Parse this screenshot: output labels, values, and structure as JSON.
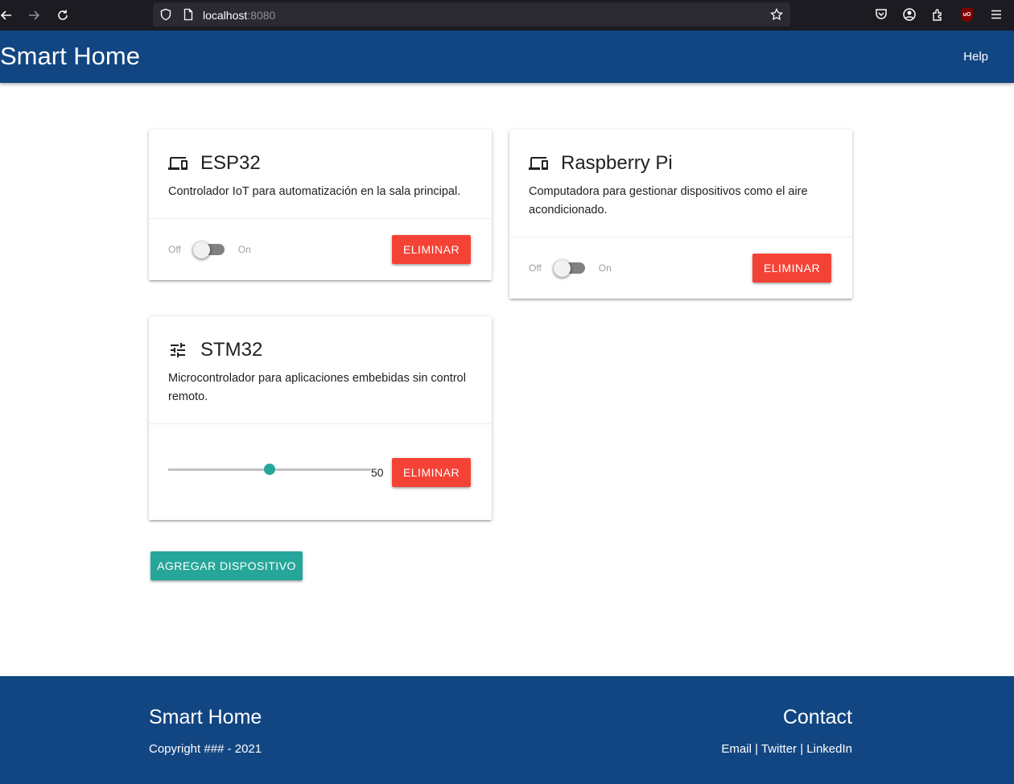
{
  "browser": {
    "url_host": "localhost",
    "url_port": ":8080"
  },
  "header": {
    "title": "Smart Home",
    "help_label": "Help"
  },
  "devices": [
    {
      "name": "ESP32",
      "icon": "devices-icon",
      "description": "Controlador IoT para automatización en la sala principal.",
      "control": "switch",
      "switch_off_label": "Off",
      "switch_on_label": "On",
      "switch_state": false,
      "delete_label": "ELIMINAR"
    },
    {
      "name": "Raspberry Pi",
      "icon": "devices-icon",
      "description": "Computadora para gestionar dispositivos como el aire acondicionado.",
      "control": "switch",
      "switch_off_label": "Off",
      "switch_on_label": "On",
      "switch_state": false,
      "delete_label": "ELIMINAR"
    },
    {
      "name": "STM32",
      "icon": "tune-icon",
      "description": "Microcontrolador para aplicaciones embebidas sin control remoto.",
      "control": "slider",
      "slider_value": "50",
      "delete_label": "ELIMINAR"
    }
  ],
  "add_device_label": "AGREGAR DISPOSITIVO",
  "footer": {
    "brand": "Smart Home",
    "copyright": "Copyright ### - 2021",
    "contact_title": "Contact",
    "links_text": "Email | Twitter | LinkedIn"
  },
  "colors": {
    "primary": "#124682",
    "danger": "#f44336",
    "accent": "#26a69a"
  }
}
